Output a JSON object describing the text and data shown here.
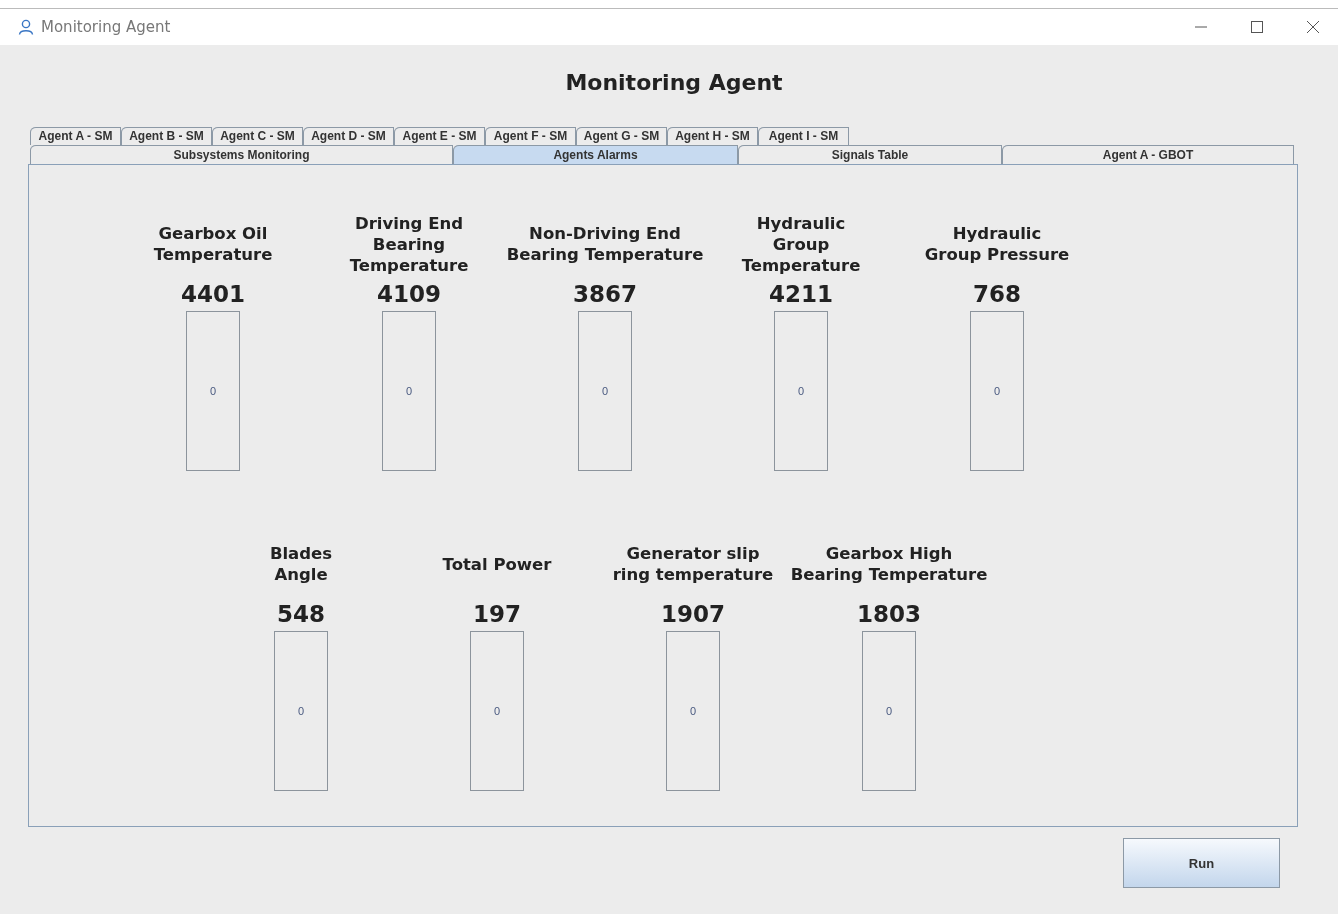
{
  "window": {
    "title": "Monitoring Agent"
  },
  "heading": "Monitoring Agent",
  "agent_tabs": [
    {
      "label": "Agent A - SM",
      "selected": false
    },
    {
      "label": "Agent B - SM",
      "selected": false
    },
    {
      "label": "Agent C - SM",
      "selected": false
    },
    {
      "label": "Agent D - SM",
      "selected": false
    },
    {
      "label": "Agent E - SM",
      "selected": false
    },
    {
      "label": "Agent F - SM",
      "selected": false
    },
    {
      "label": "Agent G - SM",
      "selected": false
    },
    {
      "label": "Agent H - SM",
      "selected": false
    },
    {
      "label": "Agent I - SM",
      "selected": false
    }
  ],
  "main_tabs": [
    {
      "label": "Subsystems Monitoring",
      "selected": false
    },
    {
      "label": "Agents Alarms",
      "selected": true
    },
    {
      "label": "Signals Table",
      "selected": false
    },
    {
      "label": "Agent A - GBOT",
      "selected": false
    }
  ],
  "alarm_rows": [
    [
      {
        "label": "Gearbox Oil Temperature",
        "count": "4401",
        "value": "0"
      },
      {
        "label": "Driving End Bearing Temperature",
        "count": "4109",
        "value": "0"
      },
      {
        "label": "Non-Driving End Bearing Temperature",
        "count": "3867",
        "value": "0"
      },
      {
        "label": "Hydraulic Group Temperature",
        "count": "4211",
        "value": "0"
      },
      {
        "label": "Hydraulic Group Pressure",
        "count": "768",
        "value": "0"
      }
    ],
    [
      {
        "label": "Blades Angle",
        "count": "548",
        "value": "0"
      },
      {
        "label": "Total Power",
        "count": "197",
        "value": "0"
      },
      {
        "label": "Generator slip ring temperature",
        "count": "1907",
        "value": "0"
      },
      {
        "label": "Gearbox High Bearing Temperature",
        "count": "1803",
        "value": "0"
      }
    ]
  ],
  "run_button": "Run"
}
